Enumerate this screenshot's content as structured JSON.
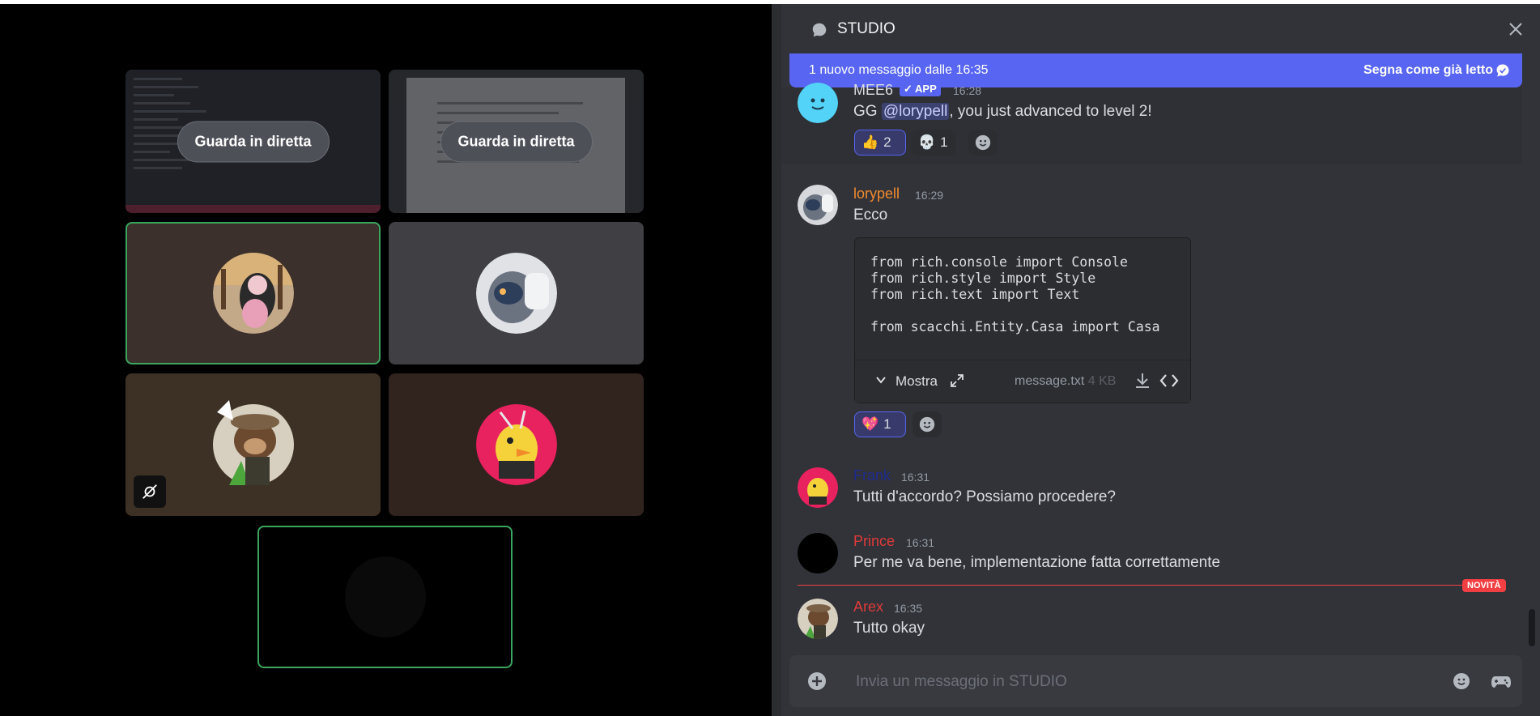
{
  "stage": {
    "tiles": [
      {
        "kind": "screen",
        "button": "Guarda in diretta"
      },
      {
        "kind": "screen",
        "button": "Guarda in diretta"
      }
    ]
  },
  "channel": {
    "name": "STUDIO",
    "new_banner": "1 nuovo messaggio dalle 16:35",
    "mark_read": "Segna come già letto",
    "new_label": "NOVITÀ",
    "composer_placeholder": "Invia un messaggio in STUDIO"
  },
  "messages": {
    "mee6": {
      "user": "MEE6",
      "badge": "✓ APP",
      "time": "16:28",
      "text_pre": "GG ",
      "mention": "@lorypell",
      "text_post": ", you just advanced to level 2!",
      "reactions": [
        {
          "emoji": "👍",
          "count": "2"
        },
        {
          "emoji": "💀",
          "count": "1"
        }
      ]
    },
    "lorypell": {
      "user": "lorypell",
      "time": "16:29",
      "text": "Ecco",
      "code": "from rich.console import Console\nfrom rich.style import Style\nfrom rich.text import Text\n\nfrom scacchi.Entity.Casa import Casa",
      "show": "Mostra",
      "file": "message.txt",
      "size": "4 KB",
      "reactions": [
        {
          "emoji": "💖",
          "count": "1"
        }
      ]
    },
    "frank": {
      "user": "Frank",
      "time": "16:31",
      "text": "Tutti d'accordo? Possiamo procedere?"
    },
    "prince": {
      "user": "Prince",
      "time": "16:31",
      "text": "Per me va bene, implementazione fatta correttamente"
    },
    "arex": {
      "user": "Arex",
      "time": "16:35",
      "text": "Tutto okay"
    }
  },
  "colors": {
    "accent": "#5865f2",
    "speaking": "#3ba55d",
    "new": "#f23f43"
  }
}
